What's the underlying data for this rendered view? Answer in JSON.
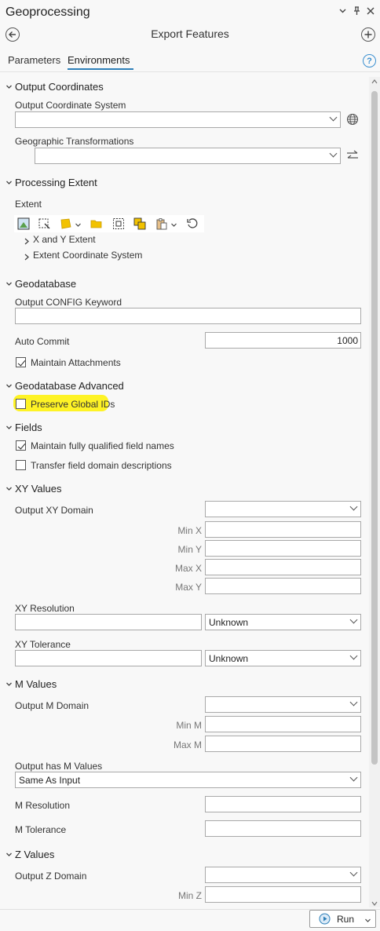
{
  "window": {
    "title": "Geoprocessing",
    "icons": [
      "chevron-down-icon",
      "pin-icon",
      "close-icon"
    ]
  },
  "nav": {
    "title": "Export Features"
  },
  "tabs": [
    {
      "label": "Parameters",
      "active": false
    },
    {
      "label": "Environments",
      "active": true
    }
  ],
  "help_glyph": "?",
  "sections": {
    "output_coordinates": {
      "title": "Output Coordinates",
      "output_coordinate_system_label": "Output Coordinate System",
      "geographic_transformations_label": "Geographic Transformations"
    },
    "processing_extent": {
      "title": "Processing Extent",
      "extent_label": "Extent",
      "xy_extent_label": "X and Y Extent",
      "extent_coord_system_label": "Extent Coordinate System"
    },
    "geodatabase": {
      "title": "Geodatabase",
      "config_keyword_label": "Output CONFIG Keyword",
      "auto_commit_label": "Auto Commit",
      "auto_commit_value": "1000",
      "maintain_attachments_label": "Maintain Attachments",
      "maintain_attachments_checked": true
    },
    "geodatabase_advanced": {
      "title": "Geodatabase Advanced",
      "preserve_global_ids_label": "Preserve Global IDs",
      "preserve_global_ids_checked": false
    },
    "fields": {
      "title": "Fields",
      "qualified_names_label": "Maintain fully qualified field names",
      "qualified_names_checked": true,
      "transfer_domain_label": "Transfer field domain descriptions",
      "transfer_domain_checked": false
    },
    "xy_values": {
      "title": "XY Values",
      "output_xy_domain_label": "Output XY Domain",
      "min_x_label": "Min X",
      "min_y_label": "Min Y",
      "max_x_label": "Max X",
      "max_y_label": "Max Y",
      "xy_resolution_label": "XY Resolution",
      "xy_resolution_unit": "Unknown",
      "xy_tolerance_label": "XY Tolerance",
      "xy_tolerance_unit": "Unknown"
    },
    "m_values": {
      "title": "M Values",
      "output_m_domain_label": "Output M Domain",
      "min_m_label": "Min M",
      "max_m_label": "Max M",
      "output_has_m_label": "Output has M Values",
      "output_has_m_value": "Same As Input",
      "m_resolution_label": "M Resolution",
      "m_tolerance_label": "M Tolerance"
    },
    "z_values": {
      "title": "Z Values",
      "output_z_domain_label": "Output Z Domain",
      "min_z_label": "Min Z"
    }
  },
  "run": {
    "label": "Run"
  },
  "colors": {
    "accent": "#2d7fb8",
    "highlight": "#fff200",
    "folder": "#f2c200"
  }
}
